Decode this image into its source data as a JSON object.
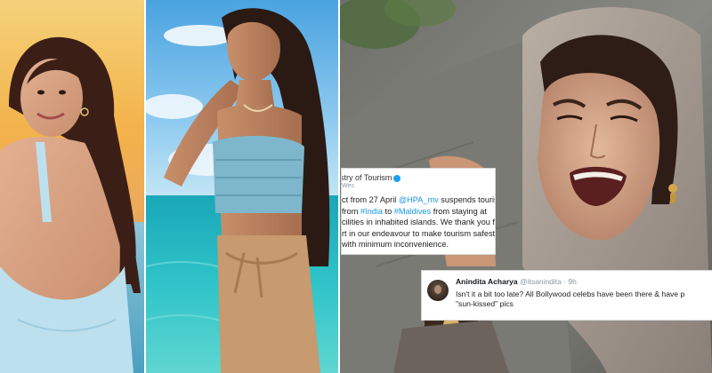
{
  "tweets": {
    "ministry": {
      "author": "stry of Tourism",
      "handle": "Wes",
      "lines": [
        {
          "pre": "ct from 27 April ",
          "link": "@HPA_mv",
          "post": " suspends tourists"
        },
        {
          "pre": "from ",
          "link": "#India",
          "mid": " to ",
          "link2": "#Maldives",
          "post": " from staying at"
        },
        {
          "pre": "cilities in inhabited islands. We thank you for"
        },
        {
          "pre": "rt in our endeavour to make tourism safest"
        },
        {
          "pre": "with minimum inconvenience."
        }
      ]
    },
    "reply": {
      "name": "Anindita Acharya",
      "handle": "@itsanindita · 9h",
      "lines": [
        "Isn't it a bit too late? All Bollywood celebs have been there & have p",
        "\"sun-kissed\" pics"
      ]
    }
  },
  "colors": {
    "link": "#1b95e0",
    "sea": "#2fb6c0",
    "sky": "#6fb9e6",
    "sunset": "#f3b24a",
    "crop_top": "#7eb6cc",
    "sand_trousers": "#c79a6f"
  }
}
